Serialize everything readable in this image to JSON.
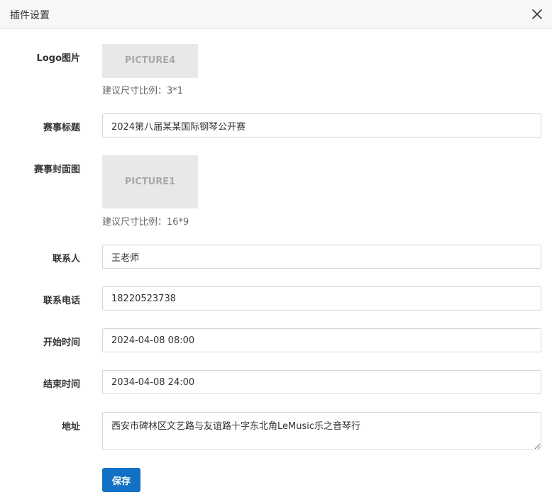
{
  "dialog": {
    "title": "插件设置",
    "close_icon": "close-icon"
  },
  "form": {
    "logo": {
      "label": "Logo图片",
      "placeholder_text": "PICTURE4",
      "hint": "建议尺寸比例：3*1"
    },
    "title": {
      "label": "赛事标题",
      "value": "2024第八届某某国际钢琴公开赛"
    },
    "cover": {
      "label": "赛事封面图",
      "placeholder_text": "PICTURE1",
      "hint": "建议尺寸比例：16*9"
    },
    "contact": {
      "label": "联系人",
      "value": "王老师"
    },
    "phone": {
      "label": "联系电话",
      "value": "18220523738"
    },
    "start_time": {
      "label": "开始时间",
      "value": "2024-04-08 08:00"
    },
    "end_time": {
      "label": "结束时间",
      "value": "2034-04-08 24:00"
    },
    "address": {
      "label": "地址",
      "value": "西安市碑林区文艺路与友谊路十字东北角LeMusic乐之音琴行"
    },
    "save_label": "保存"
  },
  "colors": {
    "primary_button": "#1271c4",
    "header_bg": "#f7f7f7",
    "picture_bg": "#e8e8e8"
  }
}
